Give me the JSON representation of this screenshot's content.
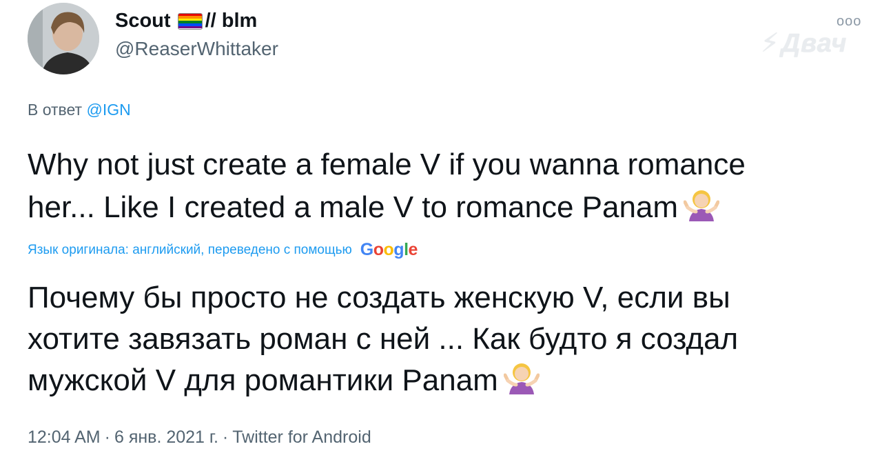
{
  "author": {
    "name": "Scout",
    "name_suffix": "// blm",
    "handle": "@ReaserWhittaker",
    "flag_colors": [
      "#e40303",
      "#ff8c00",
      "#ffed00",
      "#008026",
      "#004dff",
      "#750787"
    ]
  },
  "watermark": "Двач",
  "more_icon": "ooo",
  "reply": {
    "prefix": "В ответ",
    "mention": "@IGN"
  },
  "tweet_text": {
    "line1": "Why not just create a female V if you wanna romance",
    "line2": "her... Like I created a male V to romance Panam"
  },
  "translation_note": "Язык оригинала: английский, переведено с помощью",
  "google_logo": {
    "G": "G",
    "o1": "o",
    "o2": "o",
    "g": "g",
    "l": "l",
    "e": "e",
    "colors": [
      "#4285f4",
      "#ea4335",
      "#fbbc05",
      "#4285f4",
      "#34a853",
      "#ea4335"
    ]
  },
  "translated_text": {
    "line1": "Почему бы просто не создать женскую V, если вы",
    "line2": "хотите завязать роман с ней ... Как будто я создал",
    "line3": "мужской V для романтики Panam"
  },
  "meta": {
    "time": "12:04 AM",
    "date": "6 янв. 2021 г.",
    "source": "Twitter for Android",
    "separator": "·"
  }
}
